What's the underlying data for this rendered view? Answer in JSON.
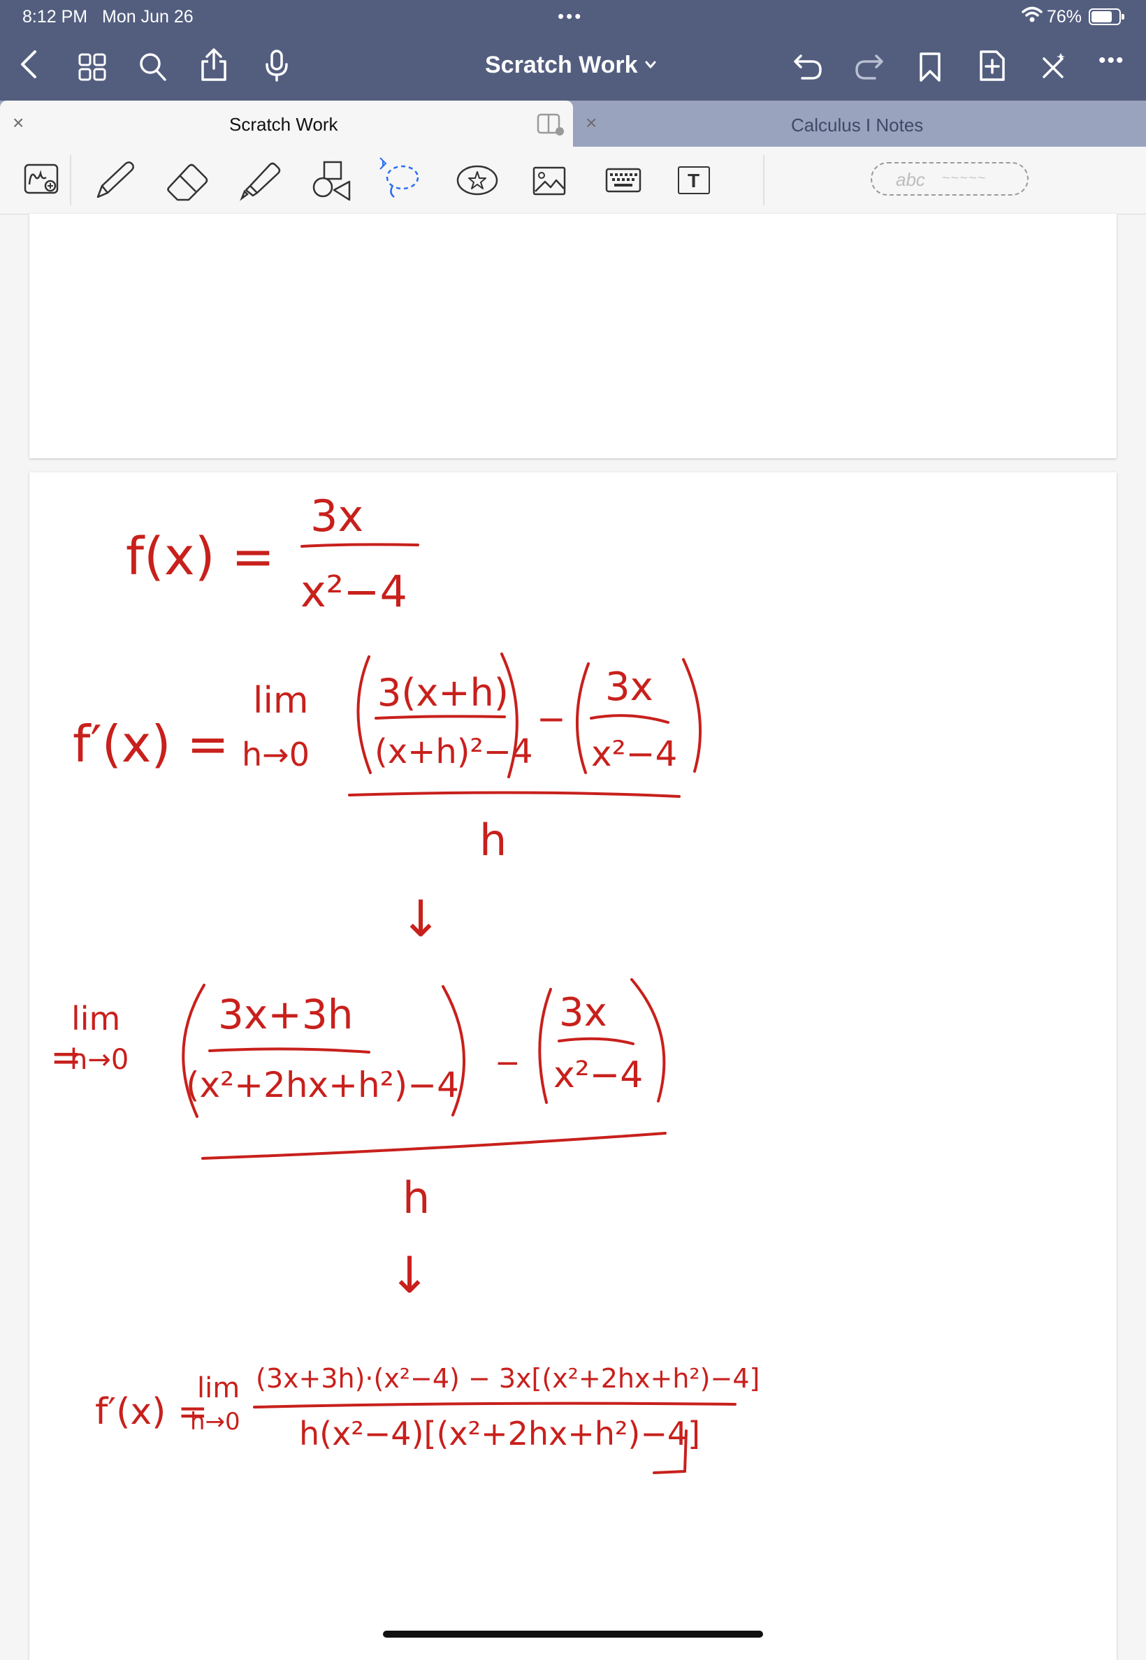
{
  "status": {
    "time": "8:12 PM",
    "date": "Mon Jun 26",
    "battery": "76%",
    "battery_level": 0.76
  },
  "header": {
    "title": "Scratch Work"
  },
  "tabs": [
    {
      "label": "Scratch Work",
      "active": true
    },
    {
      "label": "Calculus I Notes",
      "active": false
    }
  ],
  "toolbar": {
    "text_tool_glyph": "T",
    "handwriting_placeholder": "abc",
    "handwriting_squiggle": "~~~~~"
  },
  "notes": {
    "line1": {
      "lhs": "f(x) =",
      "numerator": "3x",
      "denominator": "x²−4"
    },
    "line2": {
      "lhs": "f′(x) =",
      "lim": "lim",
      "lim_sub": "h→0",
      "term1_num": "3(x+h)",
      "term1_den": "(x+h)²−4",
      "minus": "−",
      "term2_num": "3x",
      "term2_den": "x²−4",
      "denominator": "h"
    },
    "arrow": "↓",
    "line3": {
      "lhs": "=",
      "lim": "lim",
      "lim_sub": "h→0",
      "term1_num": "3x+3h",
      "term1_den": "(x²+2hx+h²)−4",
      "minus": "−",
      "term2_num": "3x",
      "term2_den": "x²−4",
      "denominator": "h"
    },
    "line4": {
      "lhs": "f′(x) =",
      "lim": "lim",
      "lim_sub": "h→0",
      "numerator": "(3x+3h)·(x²−4) − 3x[(x²+2hx+h²)−4]",
      "denominator": "h(x²−4)[(x²+2hx+h²)−4]"
    }
  },
  "colors": {
    "ink": "#c8201c",
    "header_bg": "#535e7f",
    "tabbar_bg": "#9aa3bd"
  }
}
